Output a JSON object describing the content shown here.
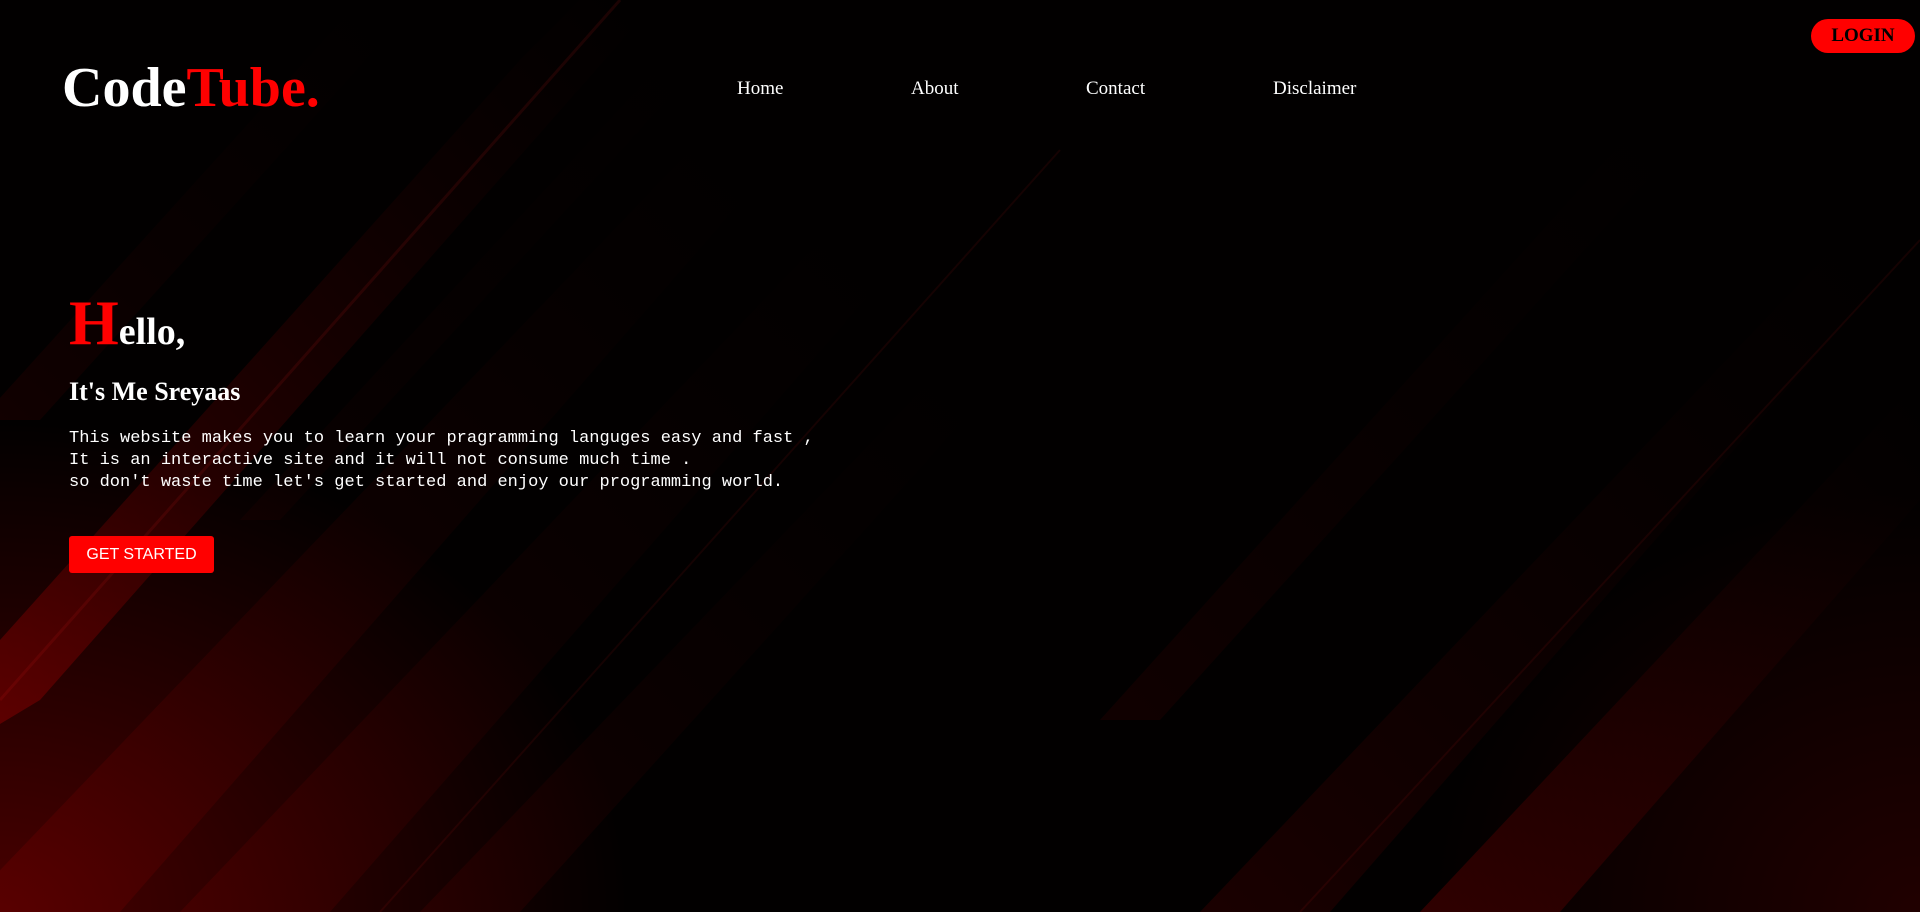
{
  "header": {
    "logo": {
      "part1": "Code",
      "part2": "Tube."
    },
    "nav": [
      {
        "label": "Home"
      },
      {
        "label": "About"
      },
      {
        "label": "Contact"
      },
      {
        "label": "Disclaimer"
      }
    ],
    "login_label": "LOGIN"
  },
  "hero": {
    "greeting_first": "H",
    "greeting_rest": "ello,",
    "subtitle": "It's Me Sreyaas",
    "description": [
      "This website makes you to learn your pragramming languges easy and fast ,",
      "It is an interactive site and it will not consume much time .",
      "so don't waste time let's get started and enjoy our programming world."
    ],
    "cta_label": "GET STARTED"
  },
  "colors": {
    "accent": "#ff0000",
    "background": "#000000",
    "text": "#ffffff"
  }
}
